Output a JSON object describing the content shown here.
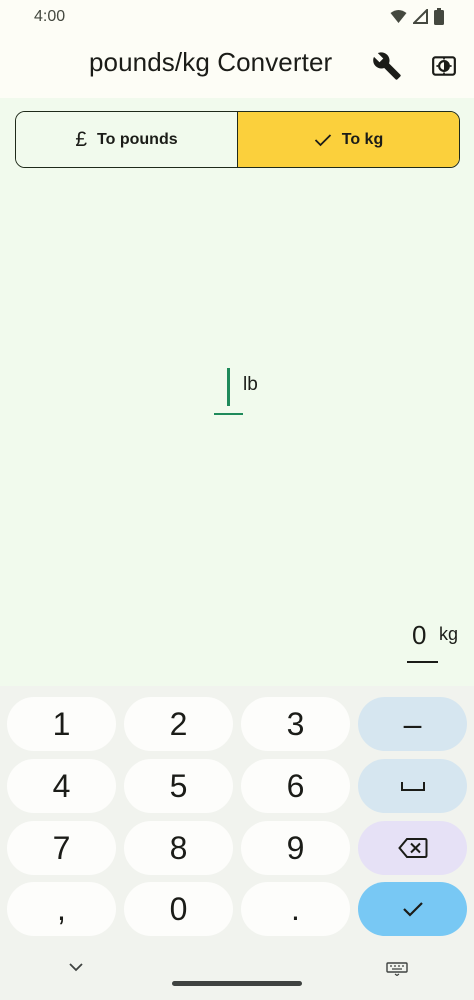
{
  "status_bar": {
    "time": "4:00",
    "icons": [
      "wifi-icon",
      "cellular-icon",
      "battery-icon"
    ]
  },
  "app_bar": {
    "title": "pounds/kg Converter",
    "actions": [
      "wrench-icon",
      "brightness-icon"
    ]
  },
  "mode_toggle": {
    "left_icon": "£",
    "left_label": "To pounds",
    "right_label": "To kg",
    "selected": "To kg"
  },
  "input": {
    "value": "",
    "unit": "lb"
  },
  "output": {
    "value": "0",
    "unit": "kg"
  },
  "keypad": {
    "keys": [
      [
        "1",
        "2",
        "3",
        "–"
      ],
      [
        "4",
        "5",
        "6",
        "␣"
      ],
      [
        "7",
        "8",
        "9",
        "backspace"
      ],
      [
        ",",
        "0",
        ".",
        "done"
      ]
    ]
  },
  "colors": {
    "background": "#f1faed",
    "bar": "#fdfdf6",
    "selected_segment": "#fbd03c",
    "accent": "#1f8a5b",
    "key": "#fdfdfb",
    "key_blue": "#d6e6f0",
    "key_lavender": "#e6e1f6",
    "key_enter": "#78c8f4"
  }
}
